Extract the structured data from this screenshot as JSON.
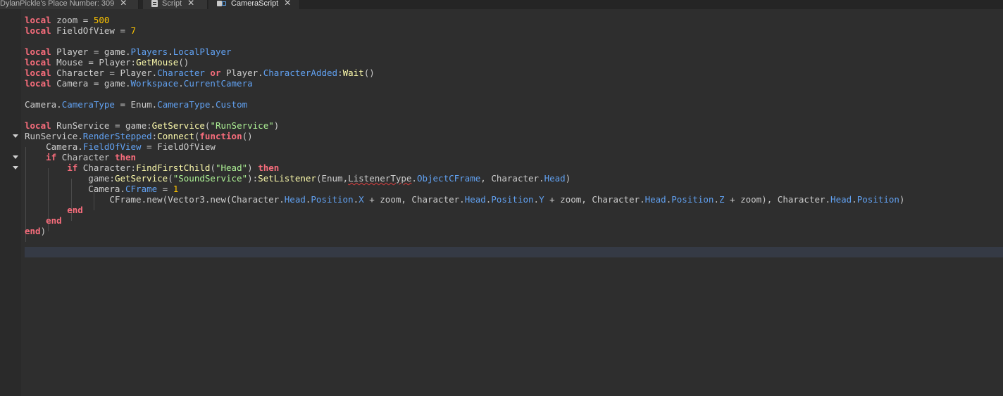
{
  "tabs": [
    {
      "label": "DylanPickle's Place Number: 309",
      "close": "✕",
      "icon": "none",
      "active": false
    },
    {
      "label": "Script",
      "close": "✕",
      "icon": "script-icon",
      "active": false
    },
    {
      "label": "CameraScript",
      "close": "✕",
      "icon": "local-script-icon",
      "active": true
    }
  ],
  "code": {
    "lines": [
      [
        [
          "kw",
          "local"
        ],
        [
          "id",
          " zoom = "
        ],
        [
          "num",
          "500"
        ]
      ],
      [
        [
          "kw",
          "local"
        ],
        [
          "id",
          " FieldOfView = "
        ],
        [
          "num",
          "7"
        ]
      ],
      [],
      [
        [
          "kw",
          "local"
        ],
        [
          "id",
          " Player = game."
        ],
        [
          "prop",
          "Players"
        ],
        [
          "id",
          "."
        ],
        [
          "prop",
          "LocalPlayer"
        ]
      ],
      [
        [
          "kw",
          "local"
        ],
        [
          "id",
          " Mouse = Player:"
        ],
        [
          "fn",
          "GetMouse"
        ],
        [
          "id",
          "()"
        ]
      ],
      [
        [
          "kw",
          "local"
        ],
        [
          "id",
          " Character = Player."
        ],
        [
          "prop",
          "Character"
        ],
        [
          "id",
          " "
        ],
        [
          "kw",
          "or"
        ],
        [
          "id",
          " Player."
        ],
        [
          "prop",
          "CharacterAdded"
        ],
        [
          "id",
          ":"
        ],
        [
          "fn",
          "Wait"
        ],
        [
          "id",
          "()"
        ]
      ],
      [
        [
          "kw",
          "local"
        ],
        [
          "id",
          " Camera = game."
        ],
        [
          "prop",
          "Workspace"
        ],
        [
          "id",
          "."
        ],
        [
          "prop",
          "CurrentCamera"
        ]
      ],
      [],
      [
        [
          "id",
          "Camera."
        ],
        [
          "prop",
          "CameraType"
        ],
        [
          "id",
          " = Enum."
        ],
        [
          "prop",
          "CameraType"
        ],
        [
          "id",
          "."
        ],
        [
          "prop",
          "Custom"
        ]
      ],
      [],
      [
        [
          "kw",
          "local"
        ],
        [
          "id",
          " RunService = game:"
        ],
        [
          "fn",
          "GetService"
        ],
        [
          "id",
          "("
        ],
        [
          "str",
          "\"RunService\""
        ],
        [
          "id",
          ")"
        ]
      ],
      [
        [
          "id",
          "RunService."
        ],
        [
          "prop",
          "RenderStepped"
        ],
        [
          "id",
          ":"
        ],
        [
          "fn",
          "Connect"
        ],
        [
          "id",
          "("
        ],
        [
          "kw",
          "function"
        ],
        [
          "id",
          "()"
        ]
      ],
      [
        [
          "id",
          "    Camera."
        ],
        [
          "prop",
          "FieldOfView"
        ],
        [
          "id",
          " = FieldOfView"
        ]
      ],
      [
        [
          "id",
          "    "
        ],
        [
          "kw",
          "if"
        ],
        [
          "id",
          " Character "
        ],
        [
          "kw",
          "then"
        ]
      ],
      [
        [
          "id",
          "        "
        ],
        [
          "kw",
          "if"
        ],
        [
          "id",
          " Character:"
        ],
        [
          "fn",
          "FindFirstChild"
        ],
        [
          "id",
          "("
        ],
        [
          "str",
          "\"Head\""
        ],
        [
          "id",
          ") "
        ],
        [
          "kw",
          "then"
        ]
      ],
      [
        [
          "id",
          "            game:"
        ],
        [
          "fn",
          "GetService"
        ],
        [
          "id",
          "("
        ],
        [
          "str",
          "\"SoundService\""
        ],
        [
          "id",
          "):"
        ],
        [
          "fn",
          "SetListener"
        ],
        [
          "id",
          "(Enum,"
        ],
        [
          "squiggle",
          "ListenerType"
        ],
        [
          "id",
          "."
        ],
        [
          "prop",
          "ObjectCFrame"
        ],
        [
          "id",
          ", Character."
        ],
        [
          "prop",
          "Head"
        ],
        [
          "id",
          ")"
        ]
      ],
      [
        [
          "id",
          "            Camera."
        ],
        [
          "prop",
          "CFrame"
        ],
        [
          "id",
          " = "
        ],
        [
          "num",
          "1"
        ]
      ],
      [
        [
          "id",
          "                CFrame.new(Vector3.new(Character."
        ],
        [
          "prop",
          "Head"
        ],
        [
          "id",
          "."
        ],
        [
          "prop",
          "Position"
        ],
        [
          "id",
          "."
        ],
        [
          "prop",
          "X"
        ],
        [
          "id",
          " + zoom, Character."
        ],
        [
          "prop",
          "Head"
        ],
        [
          "id",
          "."
        ],
        [
          "prop",
          "Position"
        ],
        [
          "id",
          "."
        ],
        [
          "prop",
          "Y"
        ],
        [
          "id",
          " + zoom, Character."
        ],
        [
          "prop",
          "Head"
        ],
        [
          "id",
          "."
        ],
        [
          "prop",
          "Position"
        ],
        [
          "id",
          "."
        ],
        [
          "prop",
          "Z"
        ],
        [
          "id",
          " + zoom), Character."
        ],
        [
          "prop",
          "Head"
        ],
        [
          "id",
          "."
        ],
        [
          "prop",
          "Position"
        ],
        [
          "id",
          ")"
        ]
      ],
      [
        [
          "id",
          "        "
        ],
        [
          "kw",
          "end"
        ]
      ],
      [
        [
          "id",
          "    "
        ],
        [
          "kw",
          "end"
        ]
      ],
      [
        [
          "kw",
          "end"
        ],
        [
          "id",
          ")"
        ]
      ]
    ]
  },
  "colors": {
    "keyword": "#f86d7c",
    "number": "#ffc600",
    "property": "#61a1f1",
    "function": "#fdfbac",
    "string": "#adf195",
    "text": "#cccccc",
    "background": "#2e2e2e"
  }
}
